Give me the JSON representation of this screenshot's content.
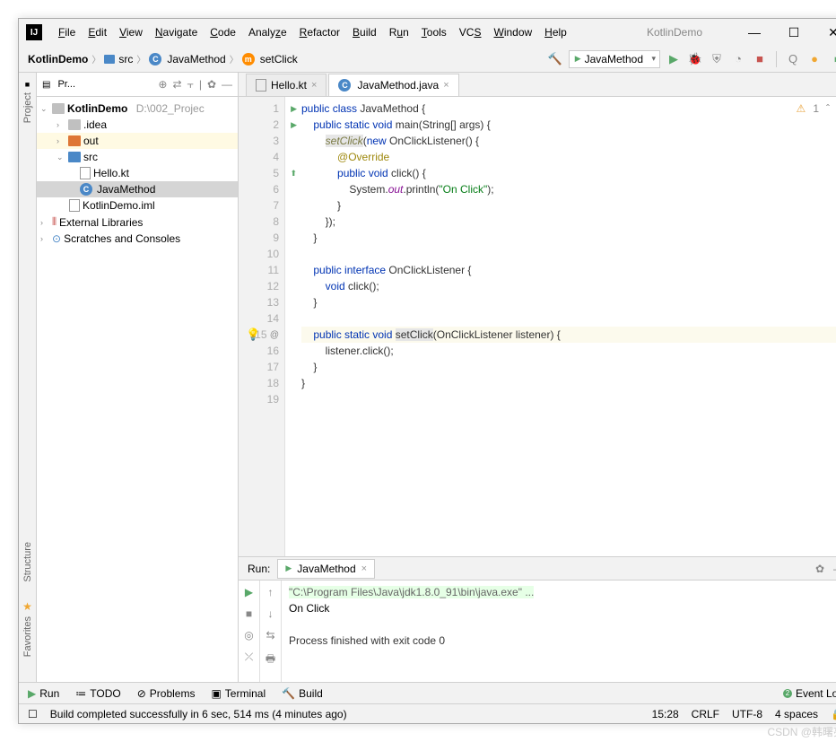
{
  "window": {
    "title": "KotlinDemo"
  },
  "menu": [
    "File",
    "Edit",
    "View",
    "Navigate",
    "Code",
    "Analyze",
    "Refactor",
    "Build",
    "Run",
    "Tools",
    "VCS",
    "Window",
    "Help"
  ],
  "breadcrumb": {
    "project": "KotlinDemo",
    "folder": "src",
    "class": "JavaMethod",
    "method": "setClick"
  },
  "run_config": "JavaMethod",
  "project_panel": {
    "title": "Pr..."
  },
  "tree": {
    "root": "KotlinDemo",
    "root_path": "D:\\002_Projec",
    "idea": ".idea",
    "out": "out",
    "src": "src",
    "hello": "Hello.kt",
    "javamethod": "JavaMethod",
    "iml": "KotlinDemo.iml",
    "ext": "External Libraries",
    "scratch": "Scratches and Consoles"
  },
  "tabs": {
    "t1": "Hello.kt",
    "t2": "JavaMethod.java"
  },
  "warnings": {
    "count": "1"
  },
  "code": {
    "l1": "public class JavaMethod {",
    "l2": "    public static void main(String[] args) {",
    "l3a": "        ",
    "l3b": "setClick",
    "l3c": "(new OnClickListener() {",
    "l4": "            @Override",
    "l5": "            public void click() {",
    "l6a": "                System.",
    "l6b": "out",
    "l6c": ".println(",
    "l6d": "\"On Click\"",
    "l6e": ");",
    "l7": "            }",
    "l8": "        });",
    "l9": "    }",
    "l10": "",
    "l11": "    public interface OnClickListener {",
    "l12": "        void click();",
    "l13": "    }",
    "l14": "",
    "l15a": "    public static void ",
    "l15b": "setClick",
    "l15c": "(OnClickListener listener) {",
    "l16": "        listener.click();",
    "l17": "    }",
    "l18": "}",
    "l19": ""
  },
  "run": {
    "label": "Run:",
    "tab": "JavaMethod",
    "cmd": "\"C:\\Program Files\\Java\\jdk1.8.0_91\\bin\\java.exe\" ...",
    "output": "On Click",
    "exit": "Process finished with exit code 0"
  },
  "bottom": {
    "run": "Run",
    "todo": "TODO",
    "problems": "Problems",
    "terminal": "Terminal",
    "build": "Build",
    "event": "Event Log"
  },
  "status": {
    "msg": "Build completed successfully in 6 sec, 514 ms (4 minutes ago)",
    "time": "15:28",
    "le": "CRLF",
    "enc": "UTF-8",
    "indent": "4 spaces"
  },
  "rails": {
    "project": "Project",
    "structure": "Structure",
    "favorites": "Favorites"
  },
  "watermark": "CSDN @韩曙亮"
}
